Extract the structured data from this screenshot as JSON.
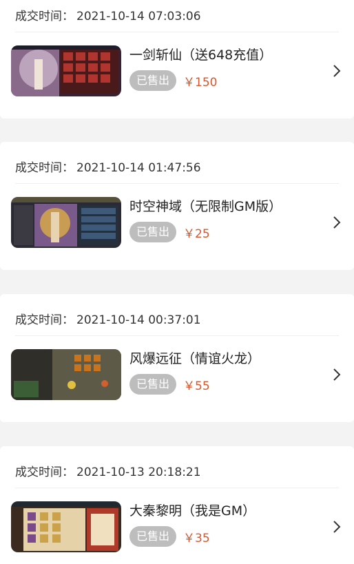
{
  "label_trade_time": "成交时间：",
  "sold_label": "已售出",
  "chevron_icon": "chevron-right-icon",
  "accent_price_color": "#d9562b",
  "items": [
    {
      "trade_time": "2021-10-14 07:03:06",
      "name": "一剑斩仙（送648充值）",
      "price": "￥150",
      "thumb_icon": "game-screenshot-icon"
    },
    {
      "trade_time": "2021-10-14 01:47:56",
      "name": "时空神域（无限制GM版）",
      "price": "￥25",
      "thumb_icon": "game-screenshot-icon"
    },
    {
      "trade_time": "2021-10-14 00:37:01",
      "name": "风爆远征（情谊火龙）",
      "price": "￥55",
      "thumb_icon": "game-screenshot-icon"
    },
    {
      "trade_time": "2021-10-13 20:18:21",
      "name": "大秦黎明（我是GM）",
      "price": "￥35",
      "thumb_icon": "game-screenshot-icon"
    }
  ]
}
